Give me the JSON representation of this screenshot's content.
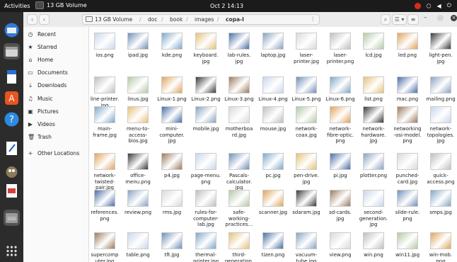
{
  "topbar": {
    "activities": "Activities",
    "app_name": "13 GB Volume",
    "clock": "Oct 2  14:13"
  },
  "path": {
    "segments": [
      "13 GB Volume",
      "doc",
      "book",
      "images",
      "copa-I"
    ]
  },
  "sidebar": {
    "items": [
      {
        "label": "Recent",
        "icon": "clock-icon"
      },
      {
        "label": "Starred",
        "icon": "star-icon"
      },
      {
        "label": "Home",
        "icon": "home-icon"
      },
      {
        "label": "Documents",
        "icon": "document-icon"
      },
      {
        "label": "Downloads",
        "icon": "download-icon"
      },
      {
        "label": "Music",
        "icon": "music-icon"
      },
      {
        "label": "Pictures",
        "icon": "pictures-icon"
      },
      {
        "label": "Videos",
        "icon": "video-icon"
      },
      {
        "label": "Trash",
        "icon": "trash-icon"
      },
      {
        "label": "Other Locations",
        "icon": "plus-icon"
      }
    ]
  },
  "files": [
    [
      "ios.png",
      "ipad.jpg",
      "kde.png",
      "keyboard.\njpg",
      "lab-rules.\njpg",
      "laptop.jpg",
      "laser-\nprinter.jpg",
      "laser-\nprinter.png",
      "lcd.jpg",
      "led.png",
      "light-pen.\njpg"
    ],
    [
      "line-printer.\njpg",
      "linus.jpg",
      "Linux-1.png",
      "Linux-2.png",
      "Linux-3.png",
      "Linux-4.png",
      "Linux-5.png",
      "Linux-6.png",
      "list.png",
      "mac.png",
      "mailing.png"
    ],
    [
      "main-\nframe.jpg",
      "menu-to-\naccess-\nbios.jpg",
      "mini-\ncomputer.\njpg",
      "mobile.jpg",
      "motherboa\nrd.jpg",
      "mouse.jpg",
      "network-\ncoax.jpg",
      "network-\nfibre-optic.\npng",
      "network-\nhardware.\njpg",
      "networking\n-osi-model.\npng",
      "network-\ntopologies.\njpg"
    ],
    [
      "network-\ntwisted-\npair.jpg",
      "office-\nmenu.png",
      "p4.jpg",
      "page-menu.\npng",
      "Pascals-\ncalculator.\njpg",
      "pc.jpg",
      "pen-drive.\njpg",
      "pi.jpg",
      "plotter.png",
      "punched-\ncard.jpg",
      "quick-\naccess.png"
    ],
    [
      "references.\npng",
      "review.png",
      "rms.jpg",
      "rules-for-\ncomputer-\nlab.jpg",
      "safe-\nworking-\npractices…",
      "scanner.jpg",
      "sdaram.jpg",
      "sd-cards.\njpg",
      "second-\ngeneration.\njpg",
      "slide-rule.\npng",
      "smps.jpg"
    ],
    [
      "supercomp\nuter.jpg",
      "table.png",
      "tft.jpg",
      "thermal-\nprinter.jpg",
      "third-\ngeneration.\njpg",
      "tizen.png",
      "vacuum-\ntube.jpg",
      "view.png",
      "win.png",
      "win11.jpg",
      "win-mob.\npng"
    ]
  ]
}
